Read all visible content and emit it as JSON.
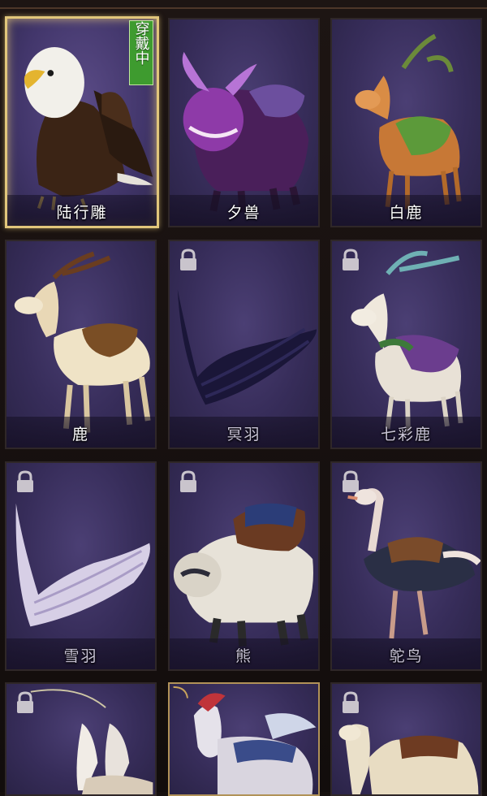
{
  "cards": [
    {
      "name": "陆行雕",
      "locked": false,
      "selected": true,
      "badge": "穿戴中"
    },
    {
      "name": "夕兽",
      "locked": false,
      "selected": false
    },
    {
      "name": "白鹿",
      "locked": false,
      "selected": false
    },
    {
      "name": "鹿",
      "locked": false,
      "selected": false
    },
    {
      "name": "冥羽",
      "locked": true,
      "selected": false
    },
    {
      "name": "七彩鹿",
      "locked": true,
      "selected": false
    },
    {
      "name": "雪羽",
      "locked": true,
      "selected": false
    },
    {
      "name": "熊",
      "locked": true,
      "selected": false
    },
    {
      "name": "鸵鸟",
      "locked": true,
      "selected": false
    },
    {
      "name": "",
      "locked": true,
      "selected": false
    },
    {
      "name": "",
      "locked": false,
      "selected": false
    },
    {
      "name": "",
      "locked": true,
      "selected": false
    }
  ]
}
